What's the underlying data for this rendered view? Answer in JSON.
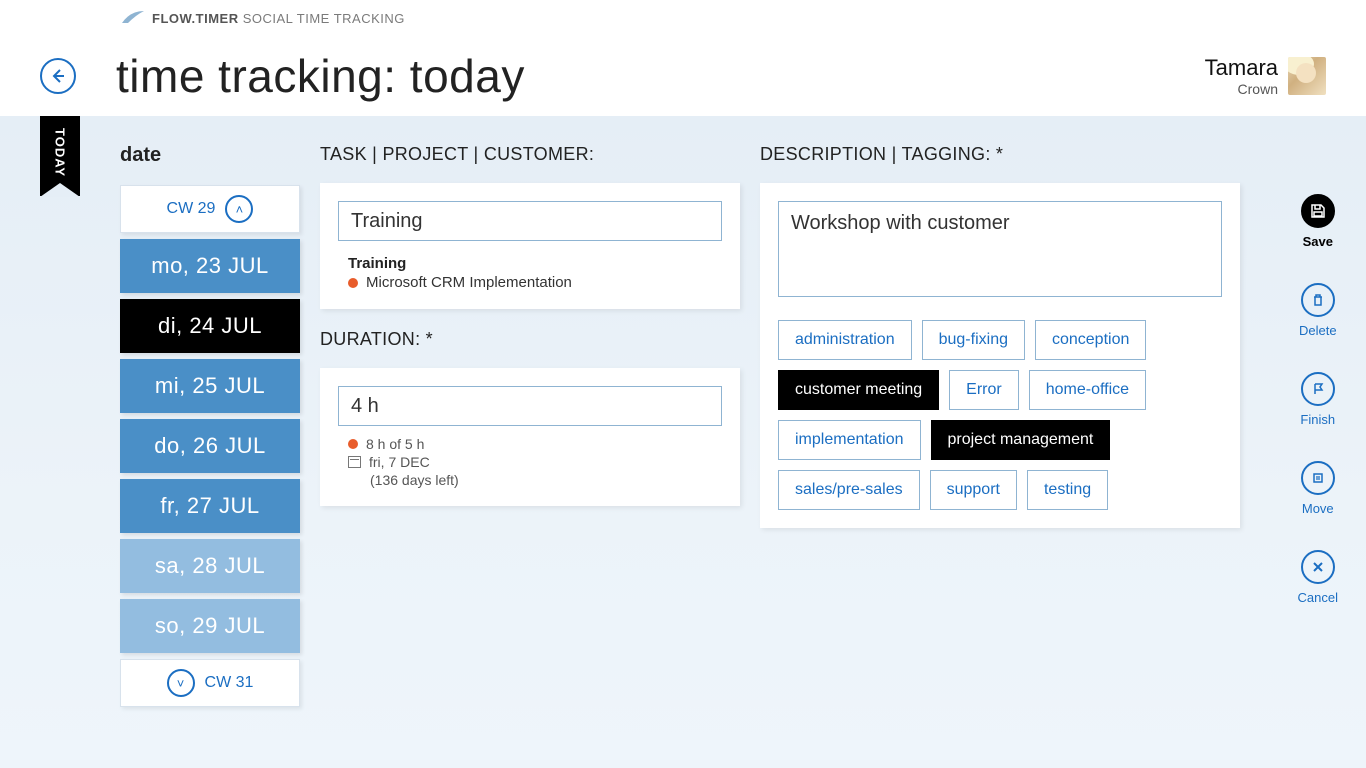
{
  "brand": {
    "name_bold": "FLOW.TIMER",
    "name_rest": " SOCIAL TIME TRACKING"
  },
  "page_title": "time tracking: today",
  "user": {
    "name": "Tamara",
    "sub": "Crown"
  },
  "ribbon": "TODAY",
  "date": {
    "heading": "date",
    "cw_prev": "CW 29",
    "cw_next": "CW 31",
    "days": [
      {
        "label": "mo, 23 JUL",
        "style": "blue"
      },
      {
        "label": "di, 24 JUL",
        "style": "black"
      },
      {
        "label": "mi, 25 JUL",
        "style": "blue"
      },
      {
        "label": "do, 26 JUL",
        "style": "blue"
      },
      {
        "label": "fr, 27 JUL",
        "style": "blue"
      },
      {
        "label": "sa, 28 JUL",
        "style": "light"
      },
      {
        "label": "so, 29 JUL",
        "style": "light"
      }
    ]
  },
  "task": {
    "section_label": "TASK | PROJECT | CUSTOMER:",
    "input_value": "Training",
    "selected_name": "Training",
    "selected_project": "Microsoft CRM Implementation"
  },
  "duration": {
    "section_label": "DURATION: *",
    "input_value": "4 h",
    "budget_line": "8 h of 5 h",
    "due_line": "fri, 7 DEC",
    "left_line": "(136 days left)"
  },
  "desc": {
    "section_label": "DESCRIPTION | TAGGING: *",
    "text": "Workshop with customer",
    "tags": [
      {
        "label": "administration",
        "sel": false
      },
      {
        "label": "bug-fixing",
        "sel": false
      },
      {
        "label": "conception",
        "sel": false
      },
      {
        "label": "customer meeting",
        "sel": true
      },
      {
        "label": "Error",
        "sel": false
      },
      {
        "label": "home-office",
        "sel": false
      },
      {
        "label": "implementation",
        "sel": false
      },
      {
        "label": "project management",
        "sel": true
      },
      {
        "label": "sales/pre-sales",
        "sel": false
      },
      {
        "label": "support",
        "sel": false
      },
      {
        "label": "testing",
        "sel": false
      }
    ]
  },
  "actions": {
    "save": "Save",
    "delete": "Delete",
    "finish": "Finish",
    "move": "Move",
    "cancel": "Cancel"
  }
}
